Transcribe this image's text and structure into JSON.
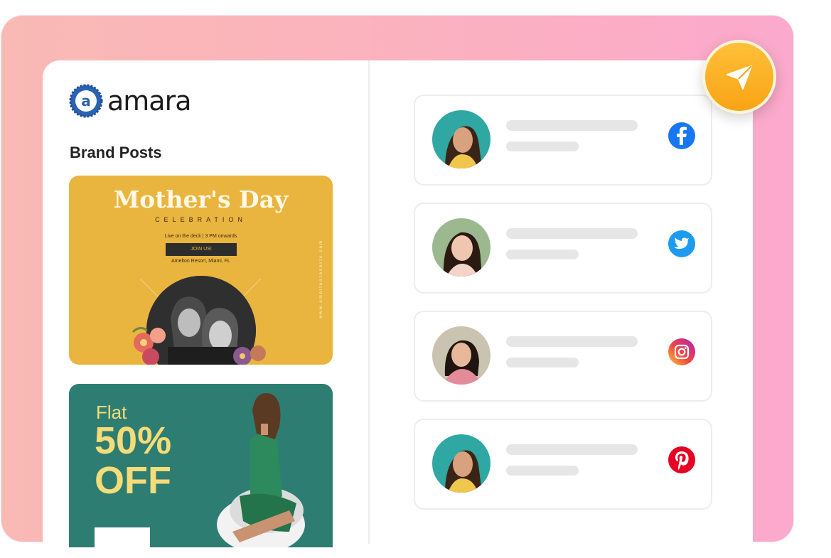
{
  "brand": {
    "name": "amara",
    "logo_letter": "a"
  },
  "section_title": "Brand Posts",
  "posts": [
    {
      "title": "Mother's Day",
      "subtitle": "CELEBRATION",
      "info": "Live on the deck | 3 PM onwards",
      "button": "JOIN US!",
      "address": "Amelton Resort, Miami, FL",
      "side_text": "www.amaltonresorts.com",
      "background": "#e9b53f"
    },
    {
      "line1": "Flat",
      "line2": "50%",
      "line3": "OFF",
      "background": "#2e7d72"
    }
  ],
  "accounts": [
    {
      "network": "facebook",
      "icon": "facebook-icon",
      "color": "#1877f2"
    },
    {
      "network": "twitter",
      "icon": "twitter-icon",
      "color": "#1d9bf0"
    },
    {
      "network": "instagram",
      "icon": "instagram-icon",
      "color": "#e1306c"
    },
    {
      "network": "pinterest",
      "icon": "pinterest-icon",
      "color": "#e60023"
    }
  ],
  "colors": {
    "accent": "#f8a414",
    "gradient_left": "#f9b9b4",
    "gradient_right": "#fba9cc"
  }
}
